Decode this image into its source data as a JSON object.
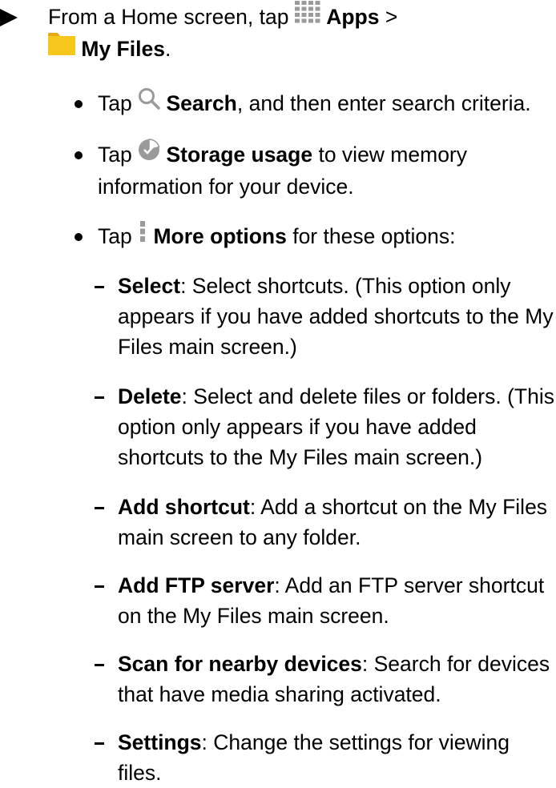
{
  "step": {
    "prefix": "From a Home screen, tap",
    "apps_label": "Apps",
    "sep": ">",
    "myfiles_label": "My Files",
    "end": "."
  },
  "bullets": [
    {
      "pre": "Tap",
      "label": "Search",
      "rest": ", and then enter search criteria.",
      "icon": "search-icon"
    },
    {
      "pre": "Tap",
      "label": "Storage usage",
      "rest": " to view memory information for your device.",
      "icon": "storage-pie-icon"
    },
    {
      "pre": "Tap",
      "label": "More options",
      "rest": " for these options:",
      "icon": "more-options-icon"
    }
  ],
  "options": [
    {
      "label": "Select",
      "rest": ": Select shortcuts. (This option only appears if you have added shortcuts to the My Files main screen.)"
    },
    {
      "label": "Delete",
      "rest": ": Select and delete files or folders. (This option only appears if you have added shortcuts to the My Files main screen.)"
    },
    {
      "label": "Add shortcut",
      "rest": ": Add a shortcut on the My Files main screen to any folder."
    },
    {
      "label": "Add FTP server",
      "rest": ": Add an FTP server shortcut on the My Files main screen."
    },
    {
      "label": "Scan for nearby devices",
      "rest": ": Search for devices that have media sharing activated."
    },
    {
      "label": "Settings",
      "rest": ": Change the settings for viewing files."
    }
  ],
  "colors": {
    "folder": "#F6C81B",
    "folder_dark": "#E9A712",
    "icon_gray": "#9A9A9A"
  }
}
